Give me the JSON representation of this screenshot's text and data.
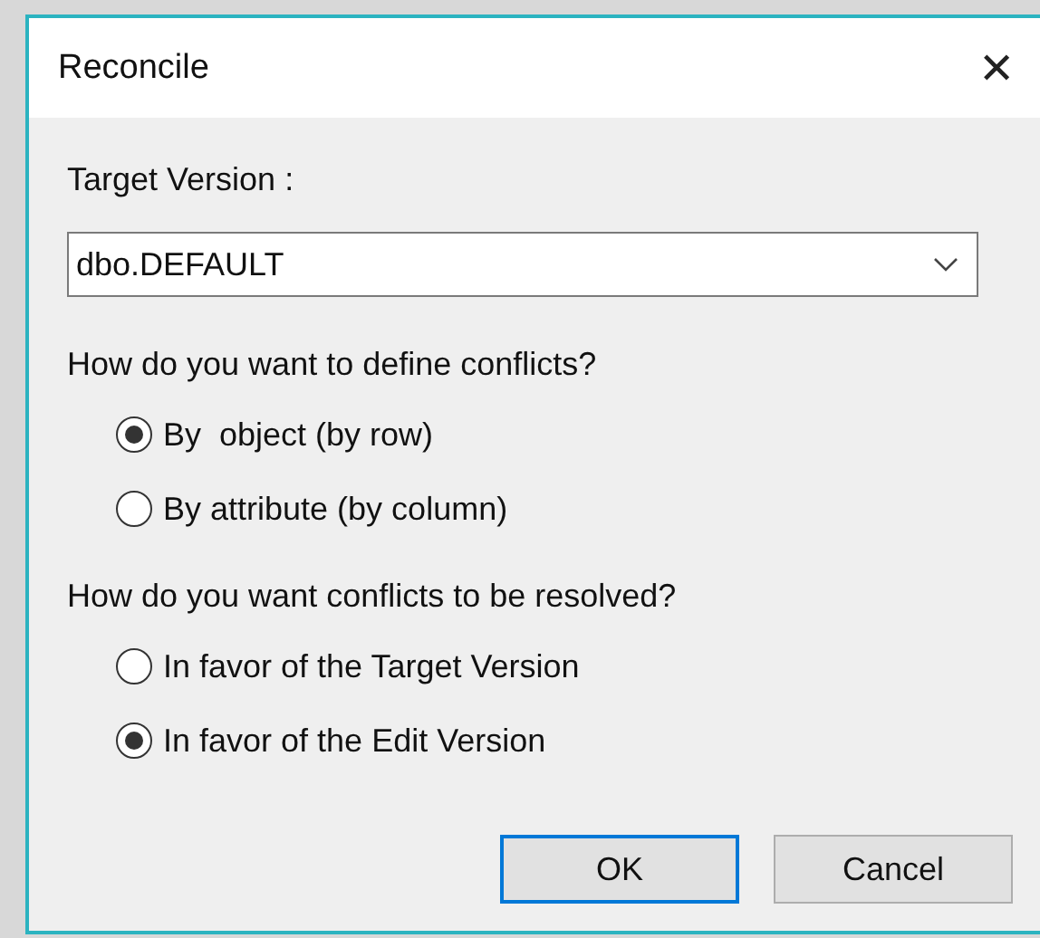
{
  "window": {
    "title": "Reconcile",
    "close": "✕"
  },
  "target": {
    "label": "Target Version :",
    "value": "dbo.DEFAULT"
  },
  "groups": [
    {
      "question": "How do you want to define conflicts?",
      "options": [
        {
          "label": "By  object (by row)",
          "selected": true
        },
        {
          "label": "By attribute (by column)",
          "selected": false
        }
      ]
    },
    {
      "question": "How do you want conflicts to be resolved?",
      "options": [
        {
          "label": "In favor of the Target Version",
          "selected": false
        },
        {
          "label": "In favor of the Edit Version",
          "selected": true
        }
      ]
    }
  ],
  "buttons": [
    {
      "label": "OK",
      "default": true
    },
    {
      "label": "Cancel",
      "default": false
    }
  ]
}
